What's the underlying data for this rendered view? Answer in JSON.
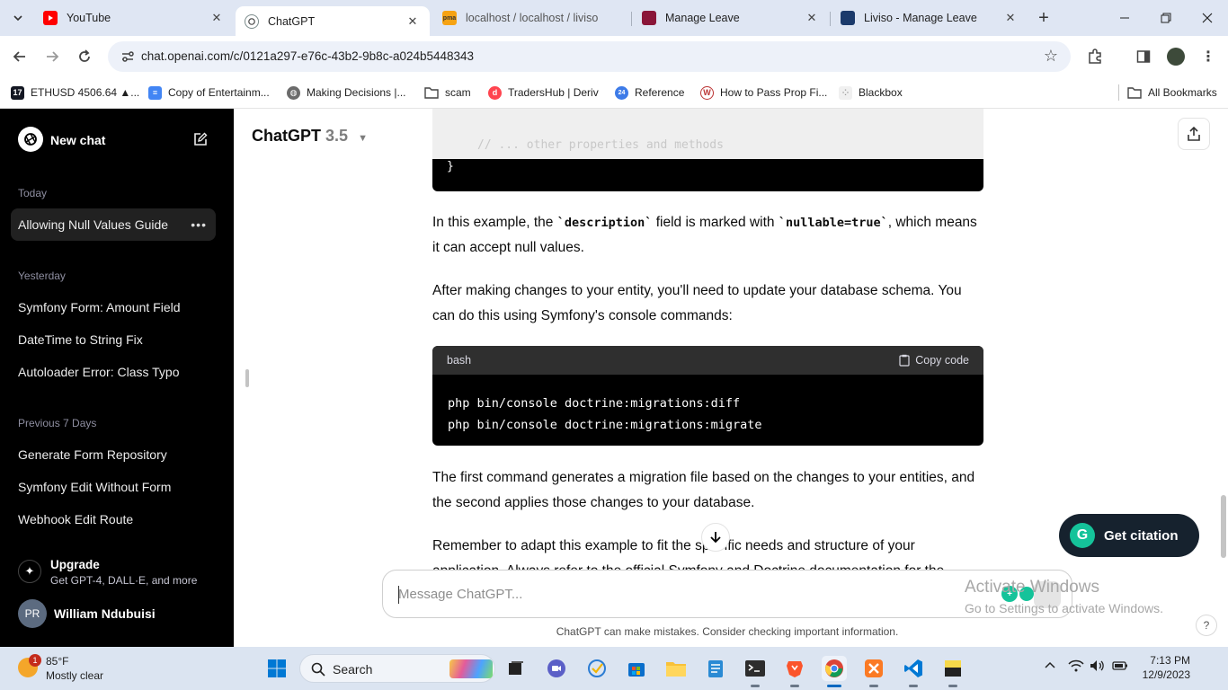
{
  "browser": {
    "tabs": [
      {
        "title": "YouTube",
        "active": false
      },
      {
        "title": "ChatGPT",
        "active": true
      },
      {
        "title": "localhost / localhost / liviso",
        "active": false
      },
      {
        "title": "Manage Leave",
        "active": false
      },
      {
        "title": "Liviso - Manage Leave",
        "active": false
      }
    ],
    "url": "chat.openai.com/c/0121a297-e76c-43b2-9b8c-a024b5448343",
    "bookmarks": [
      {
        "label": "ETHUSD 4506.64 ▲..."
      },
      {
        "label": "Copy of Entertainm..."
      },
      {
        "label": "Making Decisions |..."
      },
      {
        "label": "scam"
      },
      {
        "label": "TradersHub | Deriv"
      },
      {
        "label": "Reference"
      },
      {
        "label": "How to Pass Prop Fi..."
      },
      {
        "label": "Blackbox"
      }
    ],
    "all_bookmarks": "All Bookmarks"
  },
  "sidebar": {
    "new_chat": "New chat",
    "groups": [
      {
        "label": "Today",
        "items": [
          "Allowing Null Values Guide"
        ]
      },
      {
        "label": "Yesterday",
        "items": [
          "Symfony Form: Amount Field",
          "DateTime to String Fix",
          "Autoloader Error: Class Typo"
        ]
      },
      {
        "label": "Previous 7 Days",
        "items": [
          "Generate Form Repository",
          "Symfony Edit Without Form",
          "Webhook Edit Route"
        ]
      }
    ],
    "upgrade_title": "Upgrade",
    "upgrade_sub": "Get GPT-4, DALL·E, and more",
    "user_initials": "PR",
    "user_name": "William Ndubuisi"
  },
  "main": {
    "model_name": "ChatGPT",
    "model_version": "3.5",
    "code_top_comment": "// ... other properties and methods",
    "code_top_brace": "}",
    "para1_a": "In this example, the ",
    "para1_code1": "`description`",
    "para1_b": " field is marked with ",
    "para1_code2": "`nullable=true`",
    "para1_c": ", which means it can accept null values.",
    "para2": "After making changes to your entity, you'll need to update your database schema. You can do this using Symfony's console commands:",
    "code_lang": "bash",
    "copy_label": "Copy code",
    "code_lines": "php bin/console doctrine:migrations:diff\nphp bin/console doctrine:migrations:migrate",
    "para3": "The first command generates a migration file based on the changes to your entities, and the second applies those changes to your database.",
    "para4": "Remember to adapt this example to fit the specific needs and structure of your application. Always refer to the official Symfony and Doctrine documentation for the",
    "input_placeholder": "Message ChatGPT...",
    "disclaimer": "ChatGPT can make mistakes. Consider checking important information.",
    "get_citation": "Get citation",
    "activate_title": "Activate Windows",
    "activate_sub": "Go to Settings to activate Windows.",
    "help": "?"
  },
  "taskbar": {
    "weather_temp": "85°F",
    "weather_cond": "Mostly clear",
    "weather_badge": "1",
    "search_label": "Search",
    "time": "7:13 PM",
    "date": "12/9/2023"
  },
  "colors": {
    "sidebar_bg": "#000000",
    "tabstrip_bg": "#dfe6f3",
    "grammarly": "#15c39a",
    "taskbar_bg": "#dbe4f1"
  }
}
